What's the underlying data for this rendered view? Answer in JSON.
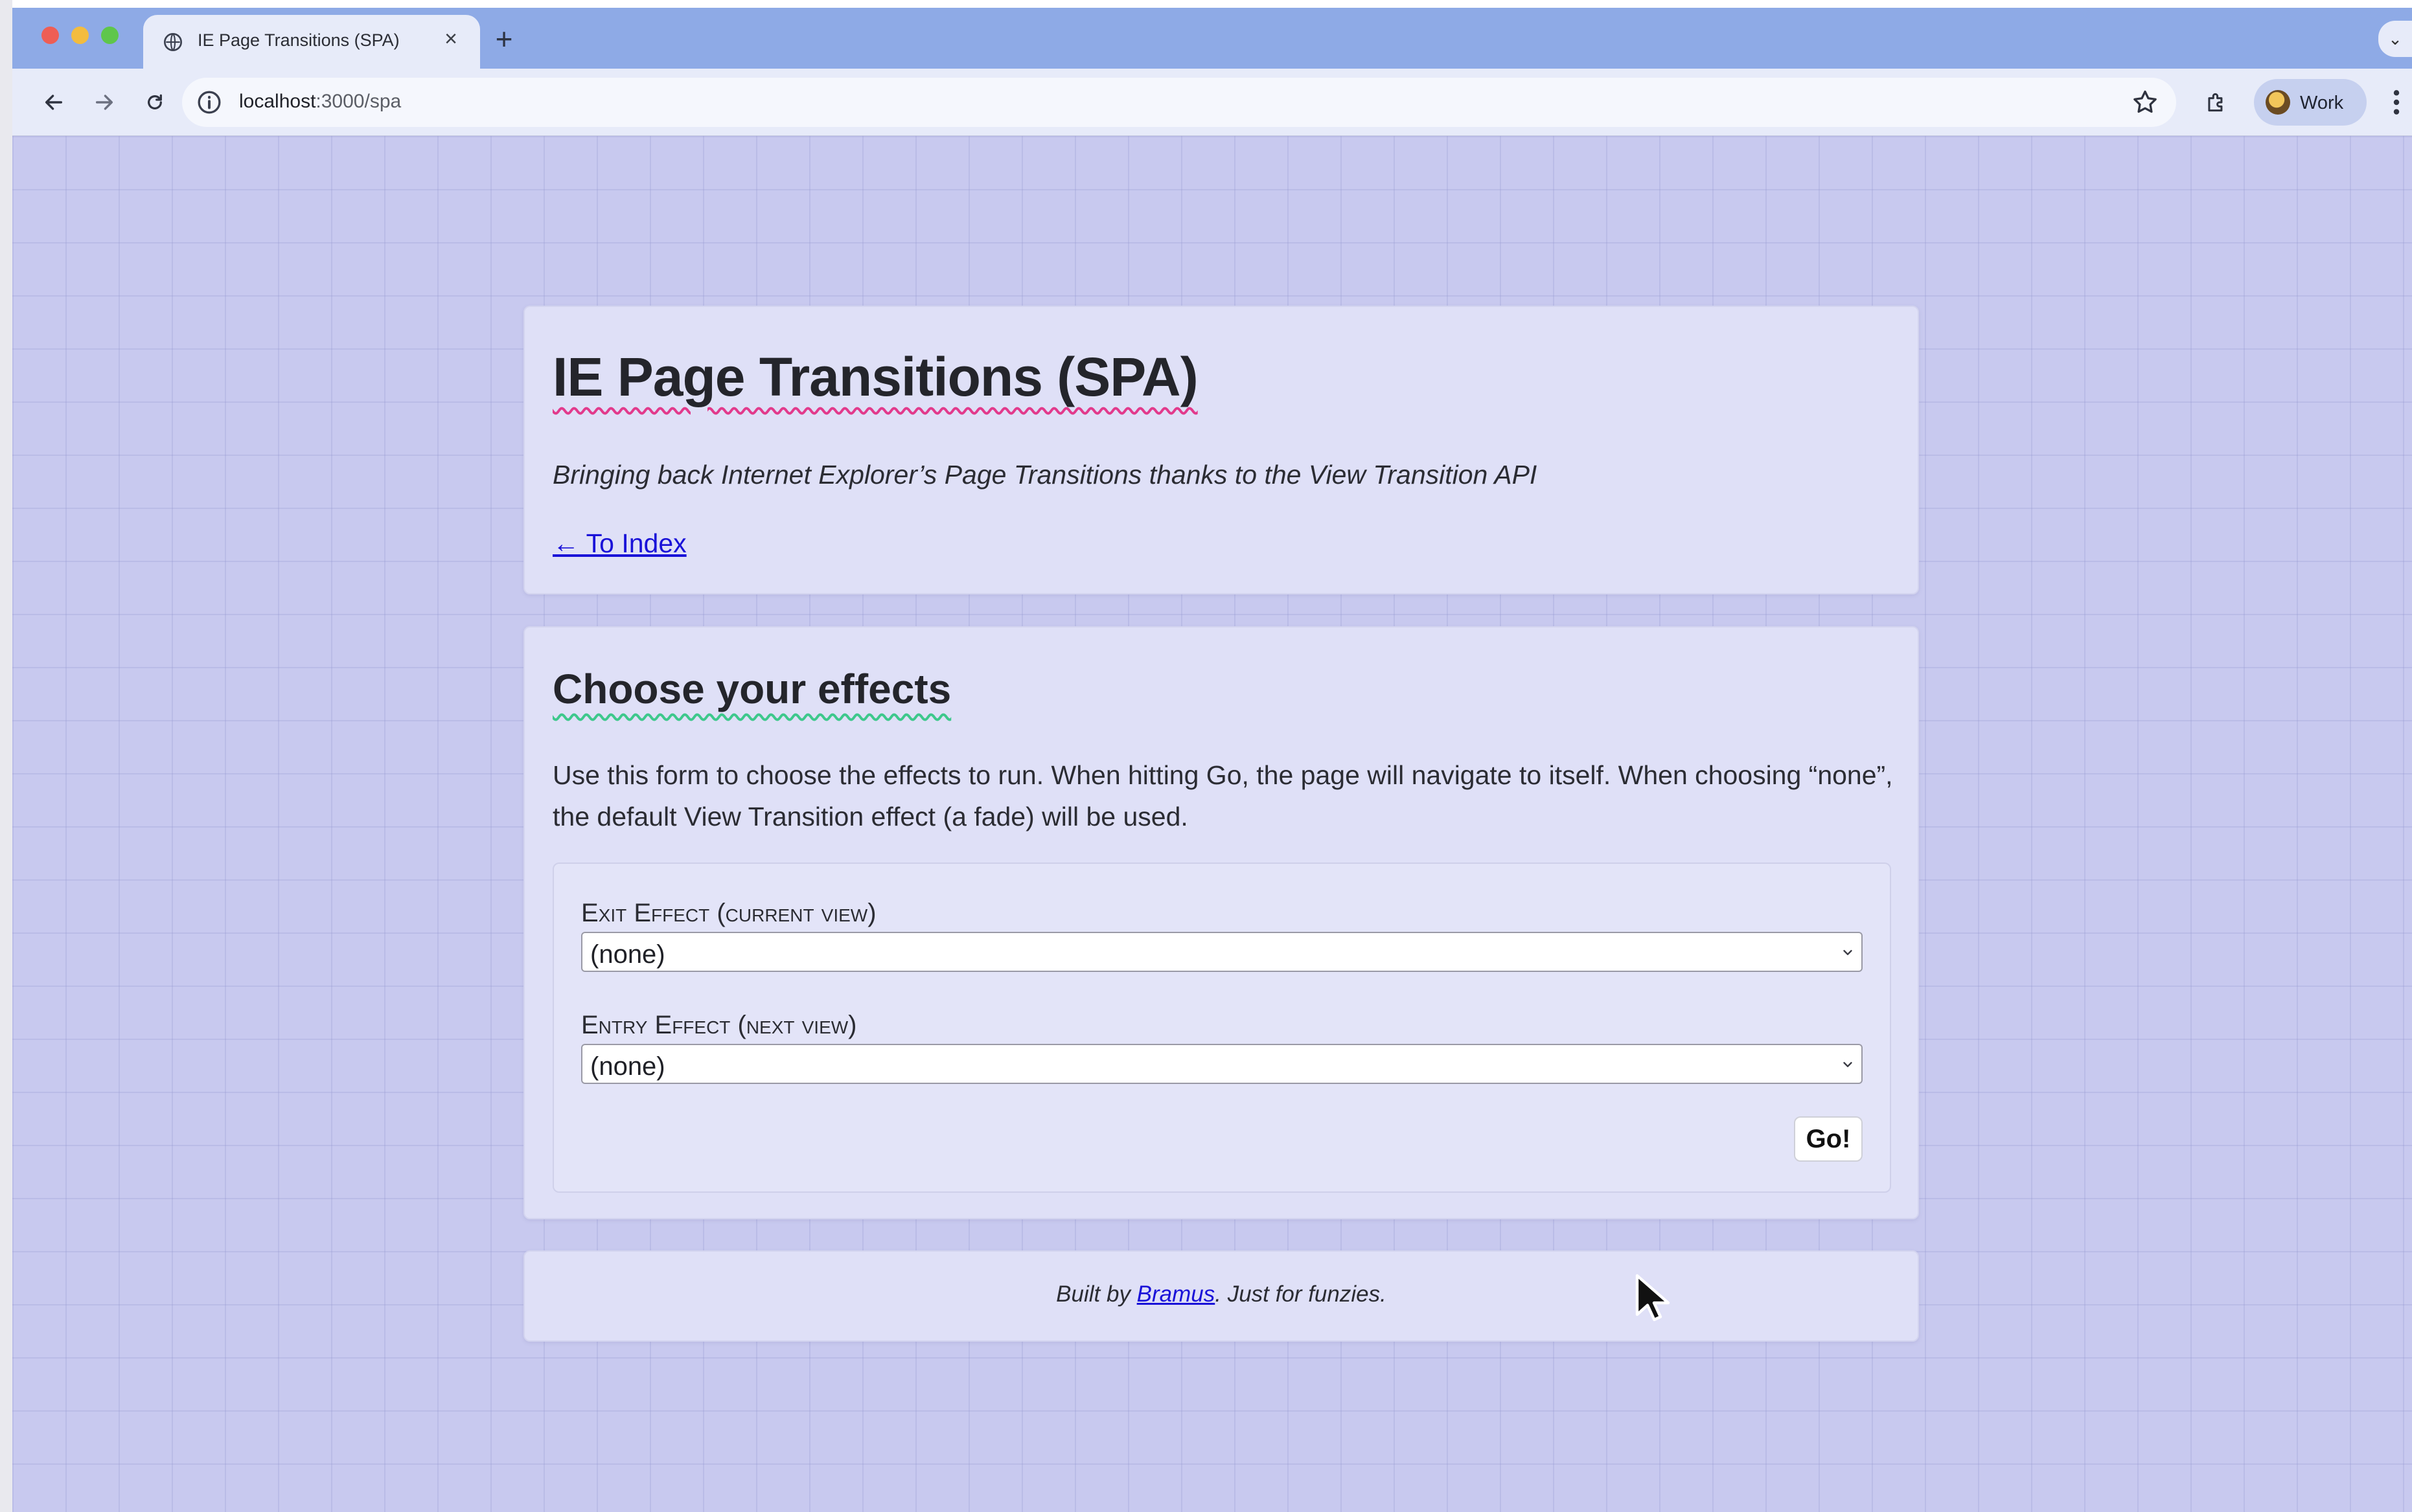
{
  "browser": {
    "tab_title": "IE Page Transitions (SPA)",
    "tab_close_glyph": "×",
    "new_tab_glyph": "+",
    "tab_menu_glyph": "⌄",
    "url_host": "localhost",
    "url_path": ":3000/spa",
    "profile_label": "Work",
    "icons": {
      "favicon": "globe-icon",
      "back": "arrow-left-icon",
      "forward": "arrow-right-icon",
      "reload": "reload-icon",
      "site_info": "info-icon",
      "bookmark": "star-icon",
      "extensions": "puzzle-icon",
      "menu": "kebab-menu-icon"
    }
  },
  "header_card": {
    "title": "IE Page Transitions (SPA)",
    "subtitle": "Bringing back Internet Explorer’s Page Transitions thanks to the View Transition API",
    "index_link": "← To Index"
  },
  "effects_card": {
    "title": "Choose your effects",
    "description": "Use this form to choose the effects to run. When hitting Go, the page will navigate to itself. When choosing “none”, the default View Transition effect (a fade) will be used.",
    "exit_label": "Exit Effect (current view)",
    "exit_value": "(none)",
    "entry_label": "Entry Effect (next view)",
    "entry_value": "(none)",
    "go_label": "Go!"
  },
  "footer": {
    "prefix": "Built by ",
    "link_text": "Bramus",
    "suffix": ". Just for funzies."
  },
  "colors": {
    "page_background": "#c8c9ef",
    "card_background": "#dfe0f7",
    "link": "#1a12d8",
    "title_underline": "#e23a8c",
    "section_underline": "#3ec88c",
    "tab_strip": "#8eaae6"
  }
}
